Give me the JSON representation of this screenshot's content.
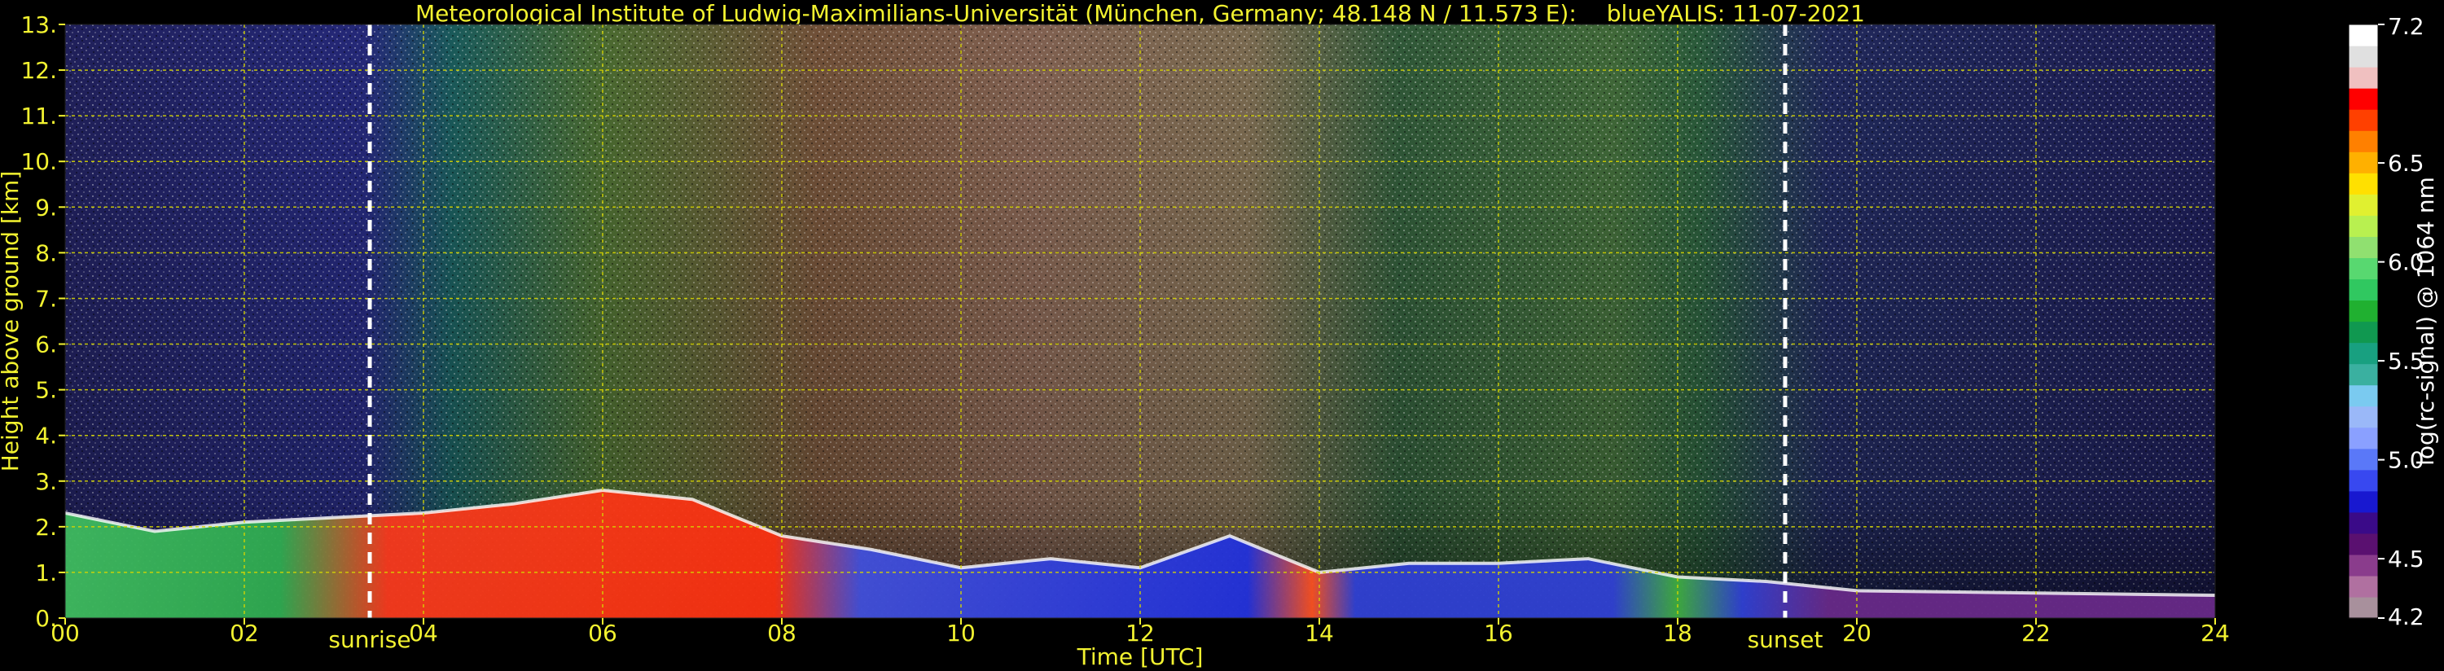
{
  "header": {
    "institute": "Meteorological Institute of Ludwig-Maximilians-Universität (München, Germany; 48.148 N / 11.573 E):",
    "instrument": "blueYALIS: 11-07-2021"
  },
  "colors": {
    "axis_text": "#f2f230",
    "grid": "#d6d600",
    "background": "#000000",
    "marker": "#ffffff"
  },
  "chart_data": {
    "type": "heatmap",
    "title": "Meteorological Institute of Ludwig-Maximilians-Universität (München, Germany; 48.148 N / 11.573 E):     blueYALIS: 11-07-2021",
    "xlabel": "Time [UTC]",
    "ylabel": "Height above ground [km]",
    "xlim": [
      0,
      24
    ],
    "ylim": [
      0,
      13
    ],
    "x_ticks": [
      "00",
      "02",
      "04",
      "06",
      "08",
      "10",
      "12",
      "14",
      "16",
      "18",
      "20",
      "22",
      "24"
    ],
    "x_tick_values": [
      0,
      2,
      4,
      6,
      8,
      10,
      12,
      14,
      16,
      18,
      20,
      22,
      24
    ],
    "y_ticks": [
      "0.",
      "1.",
      "2.",
      "3.",
      "4.",
      "5.",
      "6.",
      "7.",
      "8.",
      "9.",
      "10.",
      "11.",
      "12.",
      "13."
    ],
    "y_tick_values": [
      0,
      1,
      2,
      3,
      4,
      5,
      6,
      7,
      8,
      9,
      10,
      11,
      12,
      13
    ],
    "grid": true,
    "markers": [
      {
        "label": "sunrise",
        "x": 3.4
      },
      {
        "label": "sunset",
        "x": 19.2
      }
    ],
    "colorbar": {
      "label": "log(rc-signal) @ 1064 nm",
      "range": [
        4.2,
        7.2
      ],
      "tick_labels": [
        "4.2",
        "4.5",
        "5.0",
        "5.5",
        "6.0",
        "6.5",
        "7.2"
      ],
      "tick_values": [
        4.2,
        4.5,
        5.0,
        5.5,
        6.0,
        6.5,
        7.2
      ],
      "colors": [
        "#a8909c",
        "#b070a0",
        "#8a3c8c",
        "#5a1070",
        "#3a0a88",
        "#1818d0",
        "#3848f0",
        "#5a78f8",
        "#8aa0ff",
        "#9ab8f8",
        "#7acaf0",
        "#3ab0a0",
        "#18a080",
        "#109850",
        "#20b030",
        "#30c860",
        "#58d870",
        "#90e070",
        "#b8f050",
        "#e0f030",
        "#ffe000",
        "#ffb000",
        "#ff8000",
        "#ff4000",
        "#ff0000",
        "#f0c0c0",
        "#e0e0e0",
        "#ffffff"
      ]
    },
    "boundary_layer_top_km": [
      [
        0,
        2.3
      ],
      [
        1,
        1.9
      ],
      [
        2,
        2.1
      ],
      [
        3,
        2.2
      ],
      [
        4,
        2.3
      ],
      [
        5,
        2.5
      ],
      [
        6,
        2.8
      ],
      [
        7,
        2.6
      ],
      [
        8,
        1.8
      ],
      [
        9,
        1.5
      ],
      [
        10,
        1.1
      ],
      [
        11,
        1.3
      ],
      [
        12,
        1.1
      ],
      [
        13,
        1.8
      ],
      [
        14,
        1.0
      ],
      [
        15,
        1.2
      ],
      [
        16,
        1.2
      ],
      [
        17,
        1.3
      ],
      [
        18,
        0.9
      ],
      [
        19,
        0.8
      ],
      [
        20,
        0.6
      ],
      [
        24,
        0.5
      ]
    ]
  }
}
